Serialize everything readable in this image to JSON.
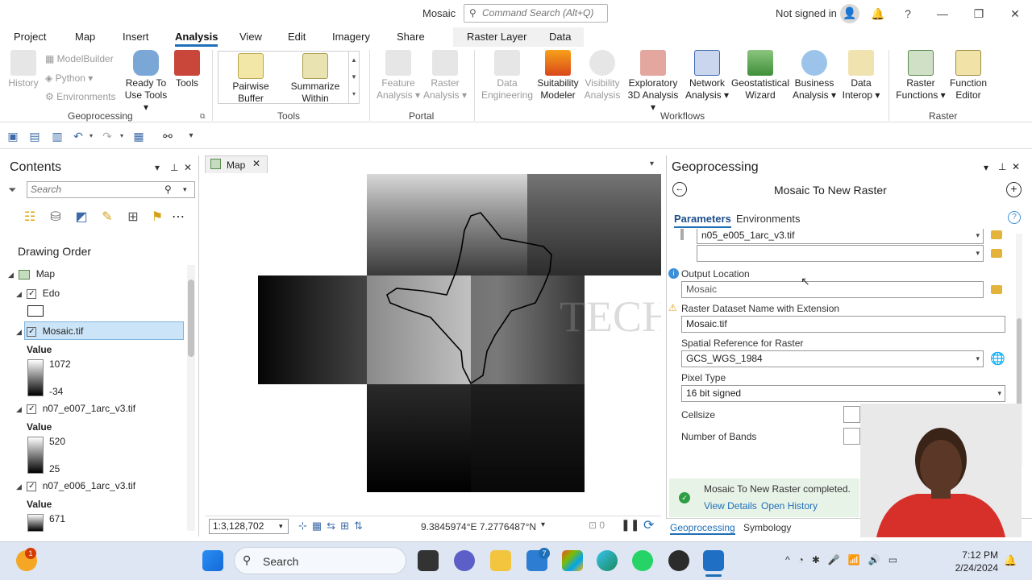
{
  "window": {
    "title": "Mosaic",
    "search_placeholder": "Command Search (Alt+Q)",
    "signed_in": "Not signed in"
  },
  "ribbon_tabs": [
    "Project",
    "Map",
    "Insert",
    "Analysis",
    "View",
    "Edit",
    "Imagery",
    "Share"
  ],
  "context_tabs": [
    "Raster Layer",
    "Data"
  ],
  "ribbon": {
    "geoprocessing": {
      "label": "Geoprocessing",
      "history": "History",
      "modelbuilder": "ModelBuilder",
      "python": "Python",
      "environments": "Environments",
      "ready_line1": "Ready To",
      "ready_line2": "Use Tools",
      "tools": "Tools"
    },
    "tools": {
      "label": "Tools",
      "pairwise_line1": "Pairwise",
      "pairwise_line2": "Buffer",
      "summarize_line1": "Summarize",
      "summarize_line2": "Within"
    },
    "portal": {
      "label": "Portal",
      "feature_line1": "Feature",
      "feature_line2": "Analysis",
      "raster_line1": "Raster",
      "raster_line2": "Analysis"
    },
    "workflows": {
      "label": "Workflows",
      "items": [
        {
          "l1": "Data",
          "l2": "Engineering"
        },
        {
          "l1": "Suitability",
          "l2": "Modeler"
        },
        {
          "l1": "Visibility",
          "l2": "Analysis"
        },
        {
          "l1": "Exploratory",
          "l2": "3D Analysis"
        },
        {
          "l1": "Network",
          "l2": "Analysis"
        },
        {
          "l1": "Geostatistical",
          "l2": "Wizard"
        },
        {
          "l1": "Business",
          "l2": "Analysis"
        },
        {
          "l1": "Data",
          "l2": "Interop"
        }
      ]
    },
    "raster": {
      "label": "Raster",
      "functions_line1": "Raster",
      "functions_line2": "Functions",
      "editor_line1": "Function",
      "editor_line2": "Editor"
    }
  },
  "contents": {
    "title": "Contents",
    "search_placeholder": "Search",
    "drawing_order": "Drawing Order",
    "layers": [
      {
        "name": "Map"
      },
      {
        "name": "Edo"
      },
      {
        "name": "Mosaic.tif",
        "value_label": "Value",
        "high": "1072",
        "low": "-34"
      },
      {
        "name": "n07_e007_1arc_v3.tif",
        "value_label": "Value",
        "high": "520",
        "low": "25"
      },
      {
        "name": "n07_e006_1arc_v3.tif",
        "value_label": "Value",
        "high": "671"
      }
    ]
  },
  "map": {
    "tab": "Map",
    "scale": "1:3,128,702",
    "coords": "9.3845974°E 7.2776487°N",
    "watermark": "TECH"
  },
  "geoprocessing": {
    "title": "Geoprocessing",
    "tool": "Mosaic To New Raster",
    "tab_parameters": "Parameters",
    "tab_environments": "Environments",
    "input_partial": "n05_e005_1arc_v3.tif",
    "output_location_label": "Output Location",
    "output_location": "Mosaic",
    "dataset_name_label": "Raster Dataset Name with Extension",
    "dataset_name": "Mosaic.tif",
    "spatial_ref_label": "Spatial Reference for  Raster",
    "spatial_ref": "GCS_WGS_1984",
    "pixel_type_label": "Pixel Type",
    "pixel_type": "16 bit signed",
    "cellsize_label": "Cellsize",
    "bands_label": "Number of Bands",
    "completed": "Mosaic To New Raster completed.",
    "view_details": "View Details",
    "open_history": "Open History",
    "bottom_tab1": "Geoprocessing",
    "bottom_tab2": "Symbology"
  },
  "taskbar": {
    "search": "Search",
    "time": "7:12 PM",
    "date": "2/24/2024",
    "badge": "1",
    "mail_badge": "7"
  }
}
